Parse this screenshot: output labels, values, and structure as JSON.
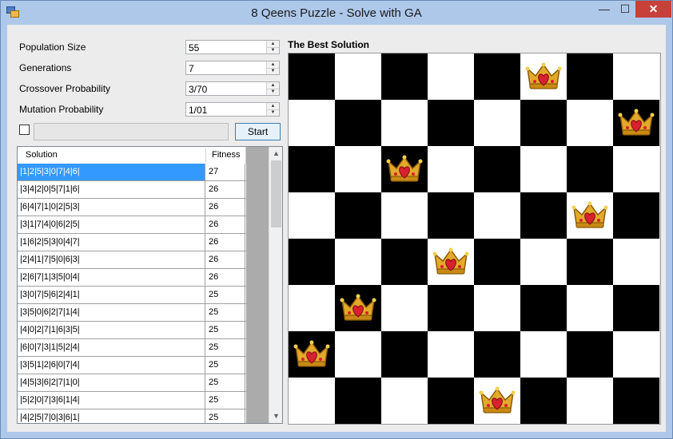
{
  "window": {
    "title": "8 Qeens Puzzle - Solve with GA",
    "buttons": {
      "minimize": "—",
      "maximize": "☐",
      "close": "✕"
    }
  },
  "params": [
    {
      "label": "Population Size",
      "value": "55"
    },
    {
      "label": "Generations",
      "value": "7"
    },
    {
      "label": "Crossover Probability",
      "value": "3/70"
    },
    {
      "label": "Mutation Probability",
      "value": "1/01"
    }
  ],
  "start_label": "Start",
  "checkbox_checked": false,
  "progress": 0,
  "table": {
    "headers": [
      "Solution",
      "Fitness"
    ],
    "selected_index": 0,
    "rows": [
      {
        "solution": "|1|2|5|3|0|7|4|6|",
        "fitness": "27"
      },
      {
        "solution": "|3|4|2|0|5|7|1|6|",
        "fitness": "26"
      },
      {
        "solution": "|6|4|7|1|0|2|5|3|",
        "fitness": "26"
      },
      {
        "solution": "|3|1|7|4|0|6|2|5|",
        "fitness": "26"
      },
      {
        "solution": "|1|6|2|5|3|0|4|7|",
        "fitness": "26"
      },
      {
        "solution": "|2|4|1|7|5|0|6|3|",
        "fitness": "26"
      },
      {
        "solution": "|2|6|7|1|3|5|0|4|",
        "fitness": "26"
      },
      {
        "solution": "|3|0|7|5|6|2|4|1|",
        "fitness": "25"
      },
      {
        "solution": "|3|5|0|6|2|7|1|4|",
        "fitness": "25"
      },
      {
        "solution": "|4|0|2|7|1|6|3|5|",
        "fitness": "25"
      },
      {
        "solution": "|6|0|7|3|1|5|2|4|",
        "fitness": "25"
      },
      {
        "solution": "|3|5|1|2|6|0|7|4|",
        "fitness": "25"
      },
      {
        "solution": "|4|5|3|6|2|7|1|0|",
        "fitness": "25"
      },
      {
        "solution": "|5|2|0|7|3|6|1|4|",
        "fitness": "25"
      },
      {
        "solution": "|4|2|5|7|0|3|6|1|",
        "fitness": "25"
      }
    ]
  },
  "board": {
    "title": "The Best Solution",
    "size": 8,
    "queen_rows_by_column": [
      6,
      5,
      2,
      4,
      7,
      0,
      3,
      1
    ],
    "colors": {
      "dark": "#000000",
      "light": "#ffffff"
    },
    "queen_icon": "crown-heart-icon"
  }
}
